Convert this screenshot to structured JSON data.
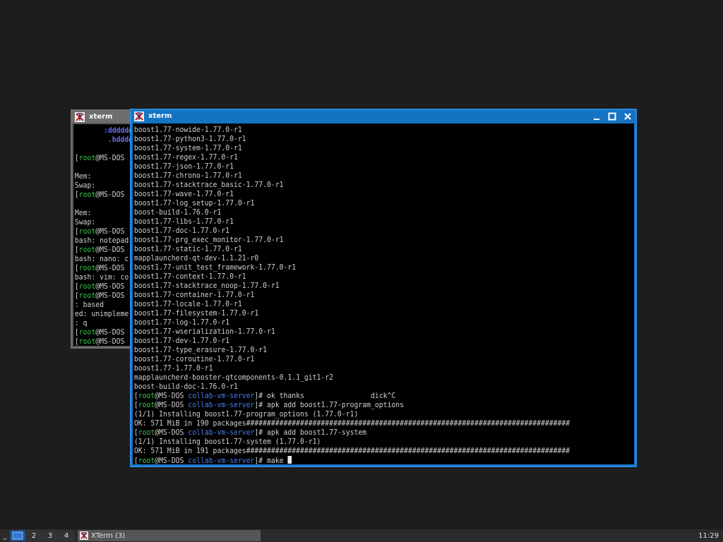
{
  "desktop": {
    "background": "#1d1d1d"
  },
  "back_window": {
    "title": "xterm",
    "lines": [
      [
        {
          "t": "       ",
          "c": ""
        },
        {
          "t": ":dddddd",
          "c": "v"
        }
      ],
      [
        {
          "t": "        ",
          "c": ""
        },
        {
          "t": ".hdddd",
          "c": "v"
        }
      ],
      [
        {
          "t": "",
          "c": ""
        }
      ],
      [
        {
          "t": "[",
          "c": ""
        },
        {
          "t": "root",
          "c": "g"
        },
        {
          "t": "@MS-DOS",
          "c": ""
        }
      ],
      [
        {
          "t": "",
          "c": ""
        }
      ],
      [
        {
          "t": "Mem:",
          "c": ""
        }
      ],
      [
        {
          "t": "Swap:",
          "c": ""
        }
      ],
      [
        {
          "t": "[",
          "c": ""
        },
        {
          "t": "root",
          "c": "g"
        },
        {
          "t": "@MS-DOS",
          "c": ""
        }
      ],
      [
        {
          "t": "",
          "c": ""
        }
      ],
      [
        {
          "t": "Mem:",
          "c": ""
        }
      ],
      [
        {
          "t": "Swap:",
          "c": ""
        }
      ],
      [
        {
          "t": "[",
          "c": ""
        },
        {
          "t": "root",
          "c": "g"
        },
        {
          "t": "@MS-DOS",
          "c": ""
        }
      ],
      [
        {
          "t": "bash: notepad",
          "c": ""
        }
      ],
      [
        {
          "t": "[",
          "c": ""
        },
        {
          "t": "root",
          "c": "g"
        },
        {
          "t": "@MS-DOS",
          "c": ""
        }
      ],
      [
        {
          "t": "bash: nano: c",
          "c": ""
        }
      ],
      [
        {
          "t": "[",
          "c": ""
        },
        {
          "t": "root",
          "c": "g"
        },
        {
          "t": "@MS-DOS",
          "c": ""
        }
      ],
      [
        {
          "t": "bash: vim: co",
          "c": ""
        }
      ],
      [
        {
          "t": "[",
          "c": ""
        },
        {
          "t": "root",
          "c": "g"
        },
        {
          "t": "@MS-DOS",
          "c": ""
        }
      ],
      [
        {
          "t": "[",
          "c": ""
        },
        {
          "t": "root",
          "c": "g"
        },
        {
          "t": "@MS-DOS",
          "c": ""
        }
      ],
      [
        {
          "t": ": based",
          "c": ""
        }
      ],
      [
        {
          "t": "ed: unimpleme",
          "c": ""
        }
      ],
      [
        {
          "t": ": q",
          "c": ""
        }
      ],
      [
        {
          "t": "[",
          "c": ""
        },
        {
          "t": "root",
          "c": "g"
        },
        {
          "t": "@MS-DOS",
          "c": ""
        }
      ],
      [
        {
          "t": "[",
          "c": ""
        },
        {
          "t": "root",
          "c": "g"
        },
        {
          "t": "@MS-DOS",
          "c": ""
        }
      ]
    ]
  },
  "front_window": {
    "title": "xterm",
    "controls": {
      "minimize": "−",
      "maximize": "□",
      "close": "✕"
    },
    "lines": [
      [
        {
          "t": "boost1.77-nowide-1.77.0-r1",
          "c": ""
        }
      ],
      [
        {
          "t": "boost1.77-python3-1.77.0-r1",
          "c": ""
        }
      ],
      [
        {
          "t": "boost1.77-system-1.77.0-r1",
          "c": ""
        }
      ],
      [
        {
          "t": "boost1.77-regex-1.77.0-r1",
          "c": ""
        }
      ],
      [
        {
          "t": "boost1.77-json-1.77.0-r1",
          "c": ""
        }
      ],
      [
        {
          "t": "boost1.77-chrono-1.77.0-r1",
          "c": ""
        }
      ],
      [
        {
          "t": "boost1.77-stacktrace_basic-1.77.0-r1",
          "c": ""
        }
      ],
      [
        {
          "t": "boost1.77-wave-1.77.0-r1",
          "c": ""
        }
      ],
      [
        {
          "t": "boost1.77-log_setup-1.77.0-r1",
          "c": ""
        }
      ],
      [
        {
          "t": "boost-build-1.76.0-r1",
          "c": ""
        }
      ],
      [
        {
          "t": "boost1.77-libs-1.77.0-r1",
          "c": ""
        }
      ],
      [
        {
          "t": "boost1.77-doc-1.77.0-r1",
          "c": ""
        }
      ],
      [
        {
          "t": "boost1.77-prg_exec_monitor-1.77.0-r1",
          "c": ""
        }
      ],
      [
        {
          "t": "boost1.77-static-1.77.0-r1",
          "c": ""
        }
      ],
      [
        {
          "t": "mapplauncherd-qt-dev-1.1.21-r0",
          "c": ""
        }
      ],
      [
        {
          "t": "boost1.77-unit_test_framework-1.77.0-r1",
          "c": ""
        }
      ],
      [
        {
          "t": "boost1.77-context-1.77.0-r1",
          "c": ""
        }
      ],
      [
        {
          "t": "boost1.77-stacktrace_noop-1.77.0-r1",
          "c": ""
        }
      ],
      [
        {
          "t": "boost1.77-container-1.77.0-r1",
          "c": ""
        }
      ],
      [
        {
          "t": "boost1.77-locale-1.77.0-r1",
          "c": ""
        }
      ],
      [
        {
          "t": "boost1.77-filesystem-1.77.0-r1",
          "c": ""
        }
      ],
      [
        {
          "t": "boost1.77-log-1.77.0-r1",
          "c": ""
        }
      ],
      [
        {
          "t": "boost1.77-wserialization-1.77.0-r1",
          "c": ""
        }
      ],
      [
        {
          "t": "boost1.77-dev-1.77.0-r1",
          "c": ""
        }
      ],
      [
        {
          "t": "boost1.77-type_erasure-1.77.0-r1",
          "c": ""
        }
      ],
      [
        {
          "t": "boost1.77-coroutine-1.77.0-r1",
          "c": ""
        }
      ],
      [
        {
          "t": "boost1.77-1.77.0-r1",
          "c": ""
        }
      ],
      [
        {
          "t": "mapplauncherd-booster-qtcomponents-0.1.1_git1-r2",
          "c": ""
        }
      ],
      [
        {
          "t": "boost-build-doc-1.76.0-r1",
          "c": ""
        }
      ],
      [
        {
          "t": "[",
          "c": ""
        },
        {
          "t": "root",
          "c": "g"
        },
        {
          "t": "@MS-DOS ",
          "c": ""
        },
        {
          "t": "collab-vm-server",
          "c": "b"
        },
        {
          "t": "]# ok thanks                dick^C",
          "c": ""
        }
      ],
      [
        {
          "t": "[",
          "c": ""
        },
        {
          "t": "root",
          "c": "g"
        },
        {
          "t": "@MS-DOS ",
          "c": ""
        },
        {
          "t": "collab-vm-server",
          "c": "b"
        },
        {
          "t": "]# apk add boost1.77-program_options",
          "c": ""
        }
      ],
      [
        {
          "t": "(1/1) Installing boost1.77-program_options (1.77.0-r1)",
          "c": ""
        }
      ],
      [
        {
          "t": "OK: 571 MiB in 190 packages##############################################################################",
          "c": ""
        }
      ],
      [
        {
          "t": "[",
          "c": ""
        },
        {
          "t": "root",
          "c": "g"
        },
        {
          "t": "@MS-DOS ",
          "c": ""
        },
        {
          "t": "collab-vm-server",
          "c": "b"
        },
        {
          "t": "]# apk add boost1.77-system",
          "c": ""
        }
      ],
      [
        {
          "t": "(1/1) Installing boost1.77-system (1.77.0-r1)",
          "c": ""
        }
      ],
      [
        {
          "t": "OK: 571 MiB in 191 packages##############################################################################",
          "c": ""
        }
      ],
      [
        {
          "t": "[",
          "c": ""
        },
        {
          "t": "root",
          "c": "g"
        },
        {
          "t": "@MS-DOS ",
          "c": ""
        },
        {
          "t": "collab-vm-server",
          "c": "b"
        },
        {
          "t": "]# make ",
          "c": ""
        },
        {
          "t": "",
          "c": "cursor"
        }
      ]
    ]
  },
  "taskbar": {
    "menu_label": "_",
    "workspaces": [
      "2",
      "3",
      "4"
    ],
    "task_label": "XTerm (3)",
    "clock": "11:29"
  }
}
